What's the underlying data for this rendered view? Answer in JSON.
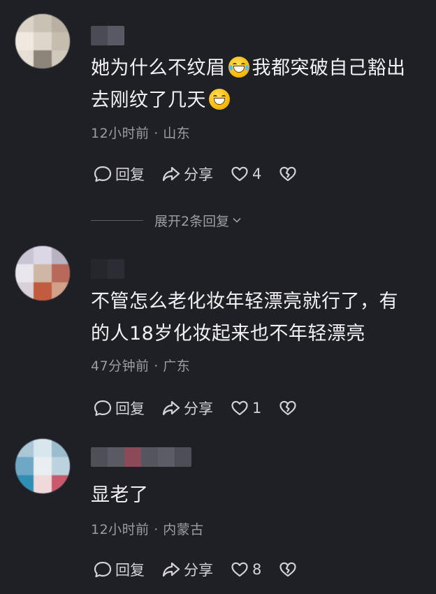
{
  "comments": [
    {
      "text_part1": "她为什么不纹眉",
      "text_part2": "我都突破自己豁出",
      "text_line2": "去刚纹了几天",
      "emoji1": "laughing-tears-emoji",
      "emoji2": "grinning-emoji",
      "meta": "12小时前 · 山东",
      "reply_label": "回复",
      "share_label": "分享",
      "like_count": "4"
    },
    {
      "text_line1": "不管怎么老化妆年轻漂亮就行了，有",
      "text_line2": "的人18岁化妆起来也不年轻漂亮",
      "meta": "47分钟前 · 广东",
      "reply_label": "回复",
      "share_label": "分享",
      "like_count": "1"
    },
    {
      "text_line1": "显老了",
      "meta": "12小时前 · 内蒙古",
      "reply_label": "回复",
      "share_label": "分享",
      "like_count": "8"
    }
  ],
  "expand_replies": "展开2条回复",
  "colors": {
    "background": "#1f2026",
    "text": "#f2f2f4",
    "meta": "#9c9ca6"
  }
}
